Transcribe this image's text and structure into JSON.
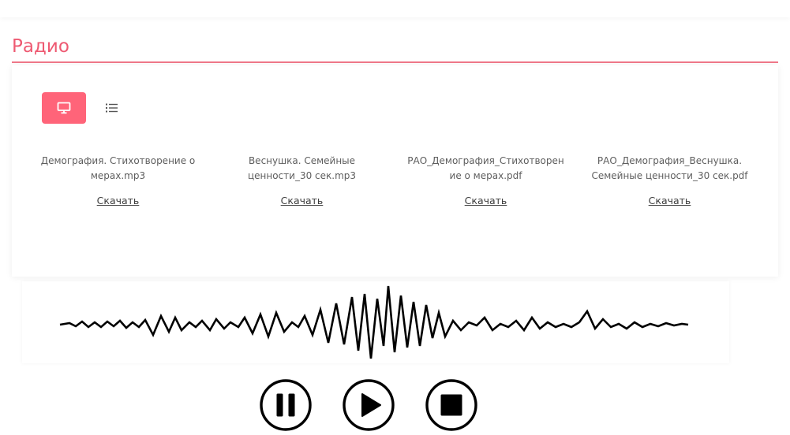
{
  "section": {
    "title": "Радио"
  },
  "view_toggle": {
    "active": "grid",
    "grid_icon": "monitor-icon",
    "list_icon": "list-icon"
  },
  "files": [
    {
      "name": "Демография. Стихотворение о мерах.mp3",
      "link_label": "Скачать"
    },
    {
      "name": "Веснушка. Семейные ценности_30 сек.mp3",
      "link_label": "Скачать"
    },
    {
      "name": "РАО_Демография_Стихотворение о мерах.pdf",
      "link_label": "Скачать"
    },
    {
      "name": "РАО_Демография_Веснушка. Семейные ценности_30 сек.pdf",
      "link_label": "Скачать"
    }
  ],
  "player": {
    "waveform_icon": "waveform-icon",
    "pause_icon": "pause-icon",
    "play_icon": "play-icon",
    "stop_icon": "stop-icon"
  },
  "colors": {
    "accent": "#ff6479",
    "title": "#ee5a72"
  }
}
